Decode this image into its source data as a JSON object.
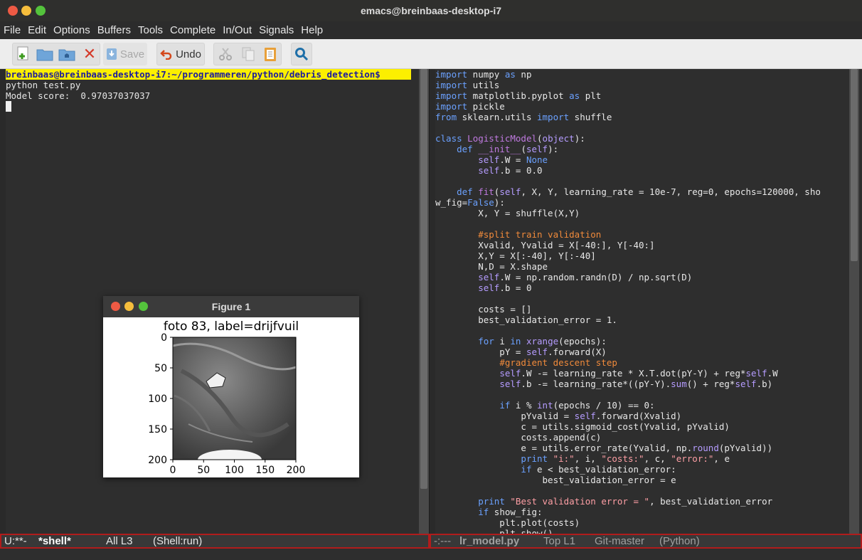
{
  "window": {
    "title": "emacs@breinbaas-desktop-i7"
  },
  "menu": [
    "File",
    "Edit",
    "Options",
    "Buffers",
    "Tools",
    "Complete",
    "In/Out",
    "Signals",
    "Help"
  ],
  "toolbar": {
    "save_label": "Save",
    "undo_label": "Undo"
  },
  "shell": {
    "prompt": "breinbaas@breinbaas-desktop-i7:~/programmeren/python/debris_detection$",
    "command": "python test.py",
    "output": "Model score:  0.97037037037"
  },
  "code_lines": [
    "import numpy as np",
    "import utils",
    "import matplotlib.pyplot as plt",
    "import pickle",
    "from sklearn.utils import shuffle",
    "",
    "class LogisticModel(object):",
    "    def __init__(self):",
    "        self.W = None",
    "        self.b = 0.0",
    "",
    "    def fit(self, X, Y, learning_rate = 10e-7, reg=0, epochs=120000, sho",
    "w_fig=False):",
    "        X, Y = shuffle(X,Y)",
    "",
    "        #split train validation",
    "        Xvalid, Yvalid = X[-40:], Y[-40:]",
    "        X,Y = X[:-40], Y[:-40]",
    "        N,D = X.shape",
    "        self.W = np.random.randn(D) / np.sqrt(D)",
    "        self.b = 0",
    "",
    "        costs = []",
    "        best_validation_error = 1.",
    "",
    "        for i in xrange(epochs):",
    "            pY = self.forward(X)",
    "            #gradient descent step",
    "            self.W -= learning_rate * X.T.dot(pY-Y) + reg*self.W",
    "            self.b -= learning_rate*((pY-Y).sum() + reg*self.b)",
    "",
    "            if i % int(epochs / 10) == 0:",
    "                pYvalid = self.forward(Xvalid)",
    "                c = utils.sigmoid_cost(Yvalid, pYvalid)",
    "                costs.append(c)",
    "                e = utils.error_rate(Yvalid, np.round(pYvalid))",
    "                print \"i:\", i, \"costs:\", c, \"error:\", e",
    "                if e < best_validation_error:",
    "                    best_validation_error = e",
    "",
    "        print \"Best validation error = \", best_validation_error",
    "        if show_fig:",
    "            plt.plot(costs)",
    "            plt.show()"
  ],
  "modeline_left": {
    "status": "U:**-",
    "buffer": "*shell*",
    "position": "All L3",
    "mode": "(Shell:run)"
  },
  "modeline_right": {
    "status": "-:---",
    "buffer": "lr_model.py",
    "position": "Top L1",
    "vc": "Git-master",
    "mode": "(Python)"
  },
  "figure": {
    "window_title": "Figure 1",
    "plot_title": "foto 83, label=drijfvuil",
    "x_ticks": [
      "0",
      "50",
      "100",
      "150",
      "200"
    ],
    "y_ticks": [
      "0",
      "50",
      "100",
      "150",
      "200"
    ]
  },
  "colors": {
    "prompt_bg": "#fcef00",
    "modeline_border": "#b11c1c",
    "keyword": "#6ba1ff",
    "comment": "#f08a3b"
  }
}
